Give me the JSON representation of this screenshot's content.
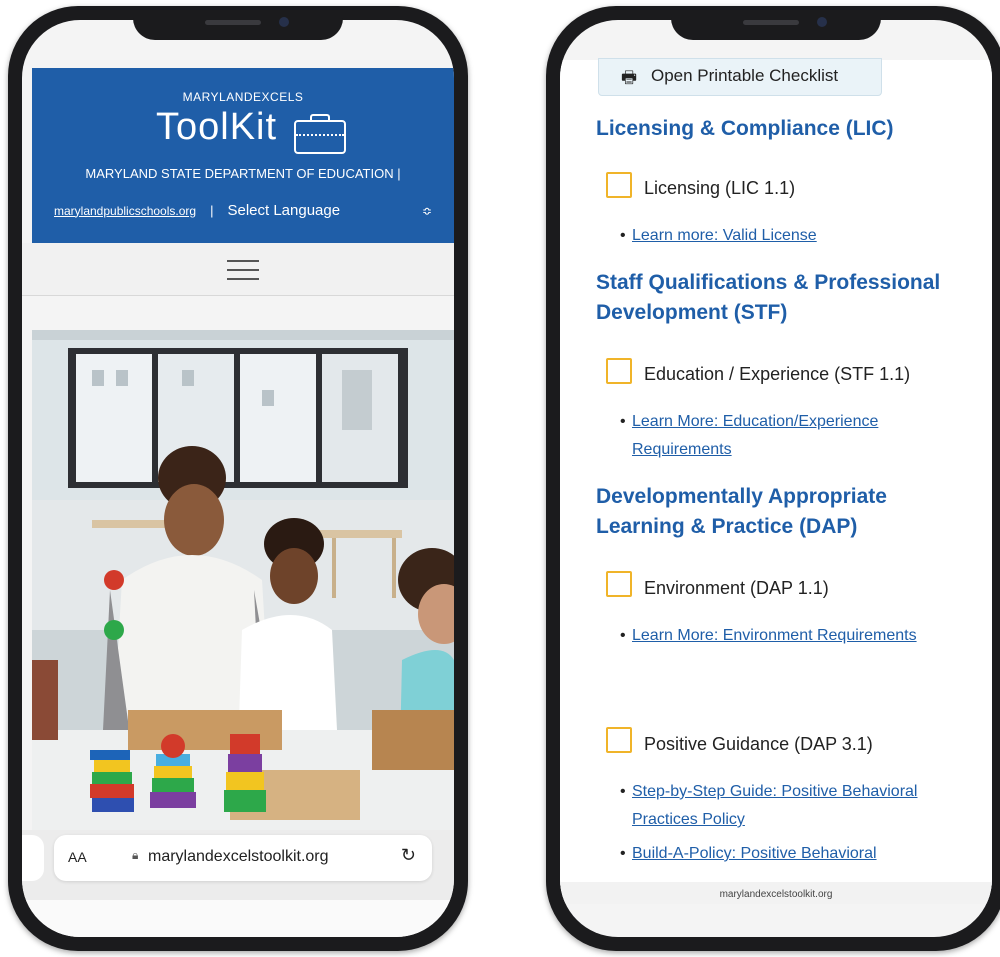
{
  "left_phone": {
    "header": {
      "brand_small": "MARYLANDEXCELS",
      "brand_big": "ToolKit",
      "agency": "MARYLAND STATE DEPARTMENT OF EDUCATION  |",
      "link": "marylandpublicschools.org",
      "separator": "|",
      "language": "Select Language",
      "language_arrow": "≎"
    },
    "browser": {
      "aa": "AA",
      "url": "marylandexcelstoolkit.org",
      "reload": "↻"
    },
    "colors": {
      "header_bg": "#1f5ea8"
    }
  },
  "right_phone": {
    "print_button": "Open Printable Checklist",
    "sections": [
      {
        "title": "Licensing & Compliance (LIC)"
      },
      {
        "title": "Staff Qualifications & Professional Development (STF)"
      },
      {
        "title": "Developmentally Appropriate Learning & Practice (DAP)"
      }
    ],
    "items": {
      "lic11": "Licensing (LIC 1.1)",
      "stf11": "Education / Experience (STF 1.1)",
      "dap11": "Environment (DAP 1.1)",
      "dap31": "Positive Guidance (DAP 3.1)"
    },
    "links": {
      "lic_license": "Learn more: Valid License",
      "stf_edu": "Learn More: Education/Experience Requirements",
      "dap_env": "Learn More: Environment Requirements",
      "dap_step": "Step-by-Step Guide: Positive Behavioral Practices Policy",
      "dap_build": "Build-A-Policy: Positive Behavioral"
    },
    "footer": "marylandexcelstoolkit.org",
    "colors": {
      "heading": "#1f5ea8",
      "checkbox": "#f0b429"
    }
  }
}
